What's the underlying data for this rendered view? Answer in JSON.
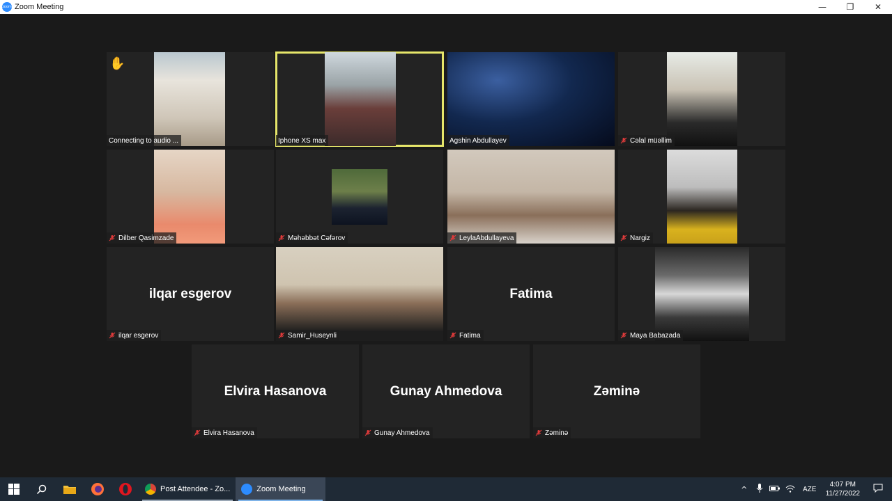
{
  "window": {
    "title": "Zoom Meeting",
    "app_icon_text": "zoom"
  },
  "window_controls": {
    "minimize": "—",
    "restore": "❐",
    "close": "✕"
  },
  "raised_hand_icon": "✋",
  "tiles": [
    {
      "label": "Connecting to audio ...",
      "has_video": true,
      "muted": false
    },
    {
      "label": "Iphone XS max",
      "has_video": true,
      "muted": false,
      "active_speaker": true
    },
    {
      "label": "Agshin Abdullayev",
      "has_video": true,
      "muted": false
    },
    {
      "label": "Cəlal müəllim",
      "has_video": true,
      "muted": true
    },
    {
      "label": "Dilber Qasimzade",
      "has_video": true,
      "muted": true
    },
    {
      "label": "Məhəbbət Cəfərov",
      "has_video": true,
      "muted": true
    },
    {
      "label": "LeylaAbdullayeva",
      "has_video": true,
      "muted": true
    },
    {
      "label": "Nargiz",
      "has_video": true,
      "muted": true
    },
    {
      "label": "ilqar esgerov",
      "display_name": "ilqar esgerov",
      "has_video": false,
      "muted": true
    },
    {
      "label": "Samir_Huseynli",
      "has_video": true,
      "muted": true
    },
    {
      "label": "Fatima",
      "display_name": "Fatima",
      "has_video": false,
      "muted": true
    },
    {
      "label": "Maya Babazada",
      "has_video": true,
      "muted": true
    },
    {
      "label": "Elvira Hasanova",
      "display_name": "Elvira Hasanova",
      "has_video": false,
      "muted": true
    },
    {
      "label": "Gunay Ahmedova",
      "display_name": "Gunay Ahmedova",
      "has_video": false,
      "muted": true
    },
    {
      "label": "Zəminə",
      "display_name": "Zəminə",
      "has_video": false,
      "muted": true
    }
  ],
  "taskbar": {
    "apps": [
      {
        "label": "Post Attendee - Zo...",
        "icon": "chrome-icon"
      },
      {
        "label": "Zoom Meeting",
        "icon": "zoom-icon",
        "active": true
      }
    ],
    "language": "AZE",
    "time": "4:07 PM",
    "date": "11/27/2022",
    "tray_chevron": "^"
  },
  "colors": {
    "active_speaker_border": "#e6e66a",
    "muted_icon": "#e03b3b",
    "zoom_blue": "#2d8cff",
    "taskbar": "#1f2a36"
  }
}
